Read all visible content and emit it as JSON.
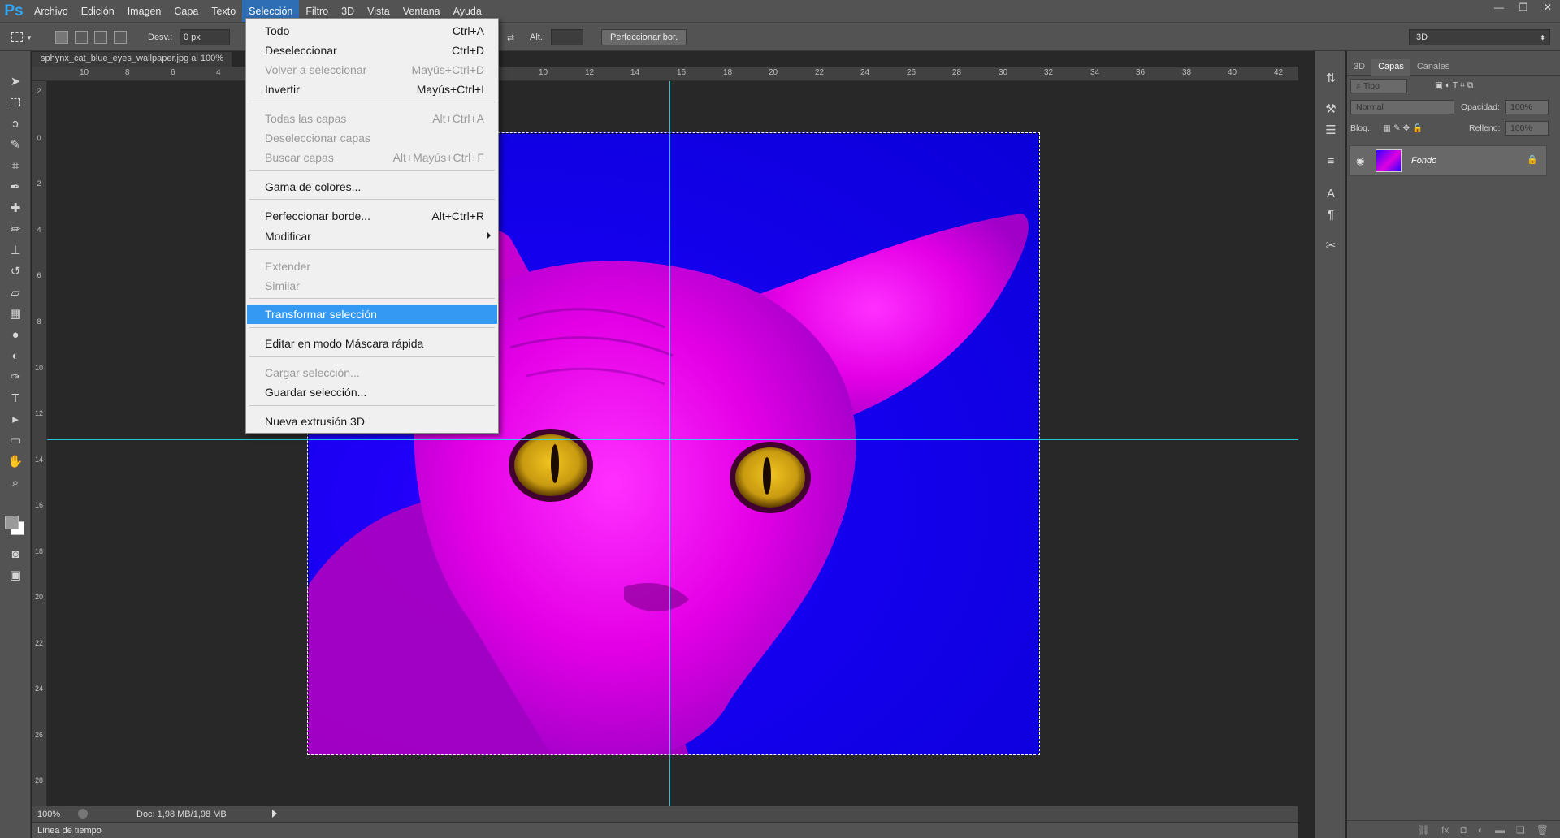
{
  "menubar": {
    "logo": "Ps",
    "items": [
      "Archivo",
      "Edición",
      "Imagen",
      "Capa",
      "Texto",
      "Selección",
      "Filtro",
      "3D",
      "Vista",
      "Ventana",
      "Ayuda"
    ],
    "active": "Selección"
  },
  "window_controls": [
    "—",
    "❐",
    "✕"
  ],
  "options": {
    "feather_label": "Desv.:",
    "feather_value": "0 px",
    "height_label": "Alt.:",
    "refine_button": "Perfeccionar bor.",
    "workspace": "3D"
  },
  "document": {
    "tab_title": "sphynx_cat_blue_eyes_wallpaper.jpg al 100%",
    "zoom": "100%",
    "doc_info": "Doc: 1,98 MB/1,98 MB"
  },
  "ruler_top": [
    "10",
    "8",
    "6",
    "4",
    "10",
    "12",
    "14",
    "16",
    "18",
    "20",
    "22",
    "24",
    "26",
    "28",
    "30",
    "32",
    "34",
    "36",
    "38",
    "40",
    "42"
  ],
  "ruler_left": [
    "2",
    "0",
    "2",
    "4",
    "6",
    "8",
    "10",
    "12",
    "14",
    "16",
    "18",
    "20",
    "22",
    "24",
    "26",
    "28"
  ],
  "timeline_label": "Línea de tiempo",
  "dropdown": [
    {
      "label": "Todo",
      "shortcut": "Ctrl+A",
      "enabled": true
    },
    {
      "label": "Deseleccionar",
      "shortcut": "Ctrl+D",
      "enabled": true
    },
    {
      "label": "Volver a seleccionar",
      "shortcut": "Mayús+Ctrl+D",
      "enabled": false
    },
    {
      "label": "Invertir",
      "shortcut": "Mayús+Ctrl+I",
      "enabled": true
    },
    {
      "label": "Todas las capas",
      "shortcut": "Alt+Ctrl+A",
      "enabled": false
    },
    {
      "label": "Deseleccionar capas",
      "shortcut": "",
      "enabled": false
    },
    {
      "label": "Buscar capas",
      "shortcut": "Alt+Mayús+Ctrl+F",
      "enabled": false
    },
    {
      "label": "Gama de colores...",
      "shortcut": "",
      "enabled": true
    },
    {
      "label": "Perfeccionar borde...",
      "shortcut": "Alt+Ctrl+R",
      "enabled": true
    },
    {
      "label": "Modificar",
      "shortcut": "",
      "enabled": true,
      "submenu": true
    },
    {
      "label": "Extender",
      "shortcut": "",
      "enabled": false
    },
    {
      "label": "Similar",
      "shortcut": "",
      "enabled": false
    },
    {
      "label": "Transformar selección",
      "shortcut": "",
      "enabled": true,
      "highlighted": true
    },
    {
      "label": "Editar en modo Máscara rápida",
      "shortcut": "",
      "enabled": true
    },
    {
      "label": "Cargar selección...",
      "shortcut": "",
      "enabled": false
    },
    {
      "label": "Guardar selección...",
      "shortcut": "",
      "enabled": true
    },
    {
      "label": "Nueva extrusión 3D",
      "shortcut": "",
      "enabled": true
    }
  ],
  "layers_panel": {
    "tabs": [
      "3D",
      "Capas",
      "Canales"
    ],
    "active_tab": "Capas",
    "filter": "Tipo",
    "blend_mode": "Normal",
    "opacity_label": "Opacidad:",
    "opacity_value": "100%",
    "lock_label": "Bloq.:",
    "fill_label": "Relleno:",
    "fill_value": "100%",
    "layer_name": "Fondo"
  },
  "colors": {
    "accent": "#3399f3",
    "image_blue": "#1400ee",
    "cat_magenta": "#e400e6",
    "guide": "#27e0f0"
  }
}
